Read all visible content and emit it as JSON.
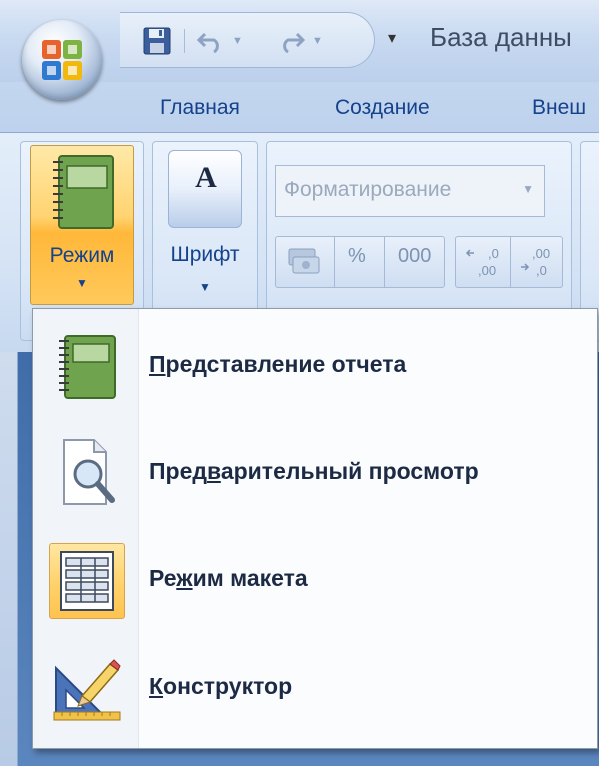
{
  "window": {
    "title": "База данны"
  },
  "tabs": [
    {
      "label": "Главная"
    },
    {
      "label": "Создание"
    },
    {
      "label": "Внеш"
    }
  ],
  "ribbon": {
    "mode_button": {
      "label": "Режим",
      "icon": "report-notebook-icon"
    },
    "font_button": {
      "label": "Шрифт",
      "icon": "font-a-icon"
    },
    "formatting_combo": {
      "value": "Форматирование"
    },
    "number_buttons": [
      "%",
      "000"
    ]
  },
  "menu": {
    "items": [
      {
        "label": "Представление отчета",
        "icon": "report-view-icon",
        "accel_index": 0,
        "active": false
      },
      {
        "label": "Предварительный просмотр",
        "icon": "print-preview-icon",
        "accel_index": 4,
        "active": false
      },
      {
        "label": "Режим макета",
        "icon": "layout-view-icon",
        "accel_index": 2,
        "active": true
      },
      {
        "label": "Конструктор",
        "icon": "design-view-icon",
        "accel_index": 0,
        "active": false
      }
    ]
  },
  "colors": {
    "accent_orange": "#ffc34f",
    "tab_text": "#15428b",
    "ribbon_bg": "#dae7f7"
  }
}
